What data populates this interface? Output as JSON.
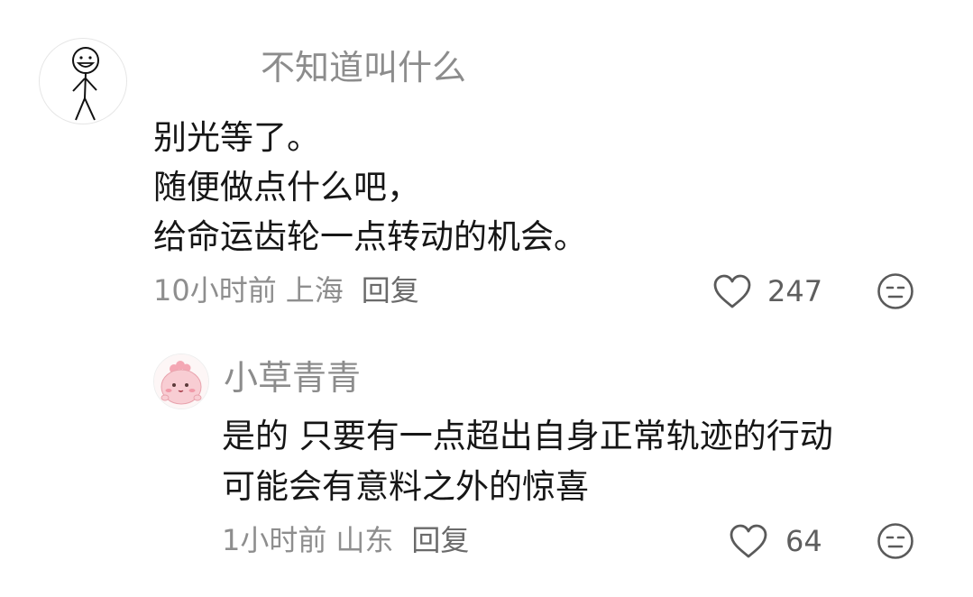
{
  "comments": [
    {
      "avatar_icon": "stick-figure-avatar",
      "username": "不知道叫什么",
      "lines": [
        "别光等了。",
        "随便做点什么吧，",
        "给命运齿轮一点转动的机会。"
      ],
      "time": "10小时前",
      "location": "上海",
      "reply_label": "回复",
      "like_icon": "heart-outline-icon",
      "like_count": "247",
      "dislike_icon": "meh-face-icon"
    },
    {
      "avatar_icon": "pink-cartoon-avatar",
      "username": "小草青青",
      "lines": [
        "是的 只要有一点超出自身正常轨迹的行动",
        "可能会有意料之外的惊喜"
      ],
      "time": "1小时前",
      "location": "山东",
      "reply_label": "回复",
      "like_icon": "heart-outline-icon",
      "like_count": "64",
      "dislike_icon": "meh-face-icon"
    }
  ],
  "colors": {
    "username": "#8c8c8c",
    "body_text": "#161616",
    "meta_text": "#8e8e8e",
    "icon_stroke": "#5a5a5a",
    "avatar_pink": "#f7c9cf"
  }
}
